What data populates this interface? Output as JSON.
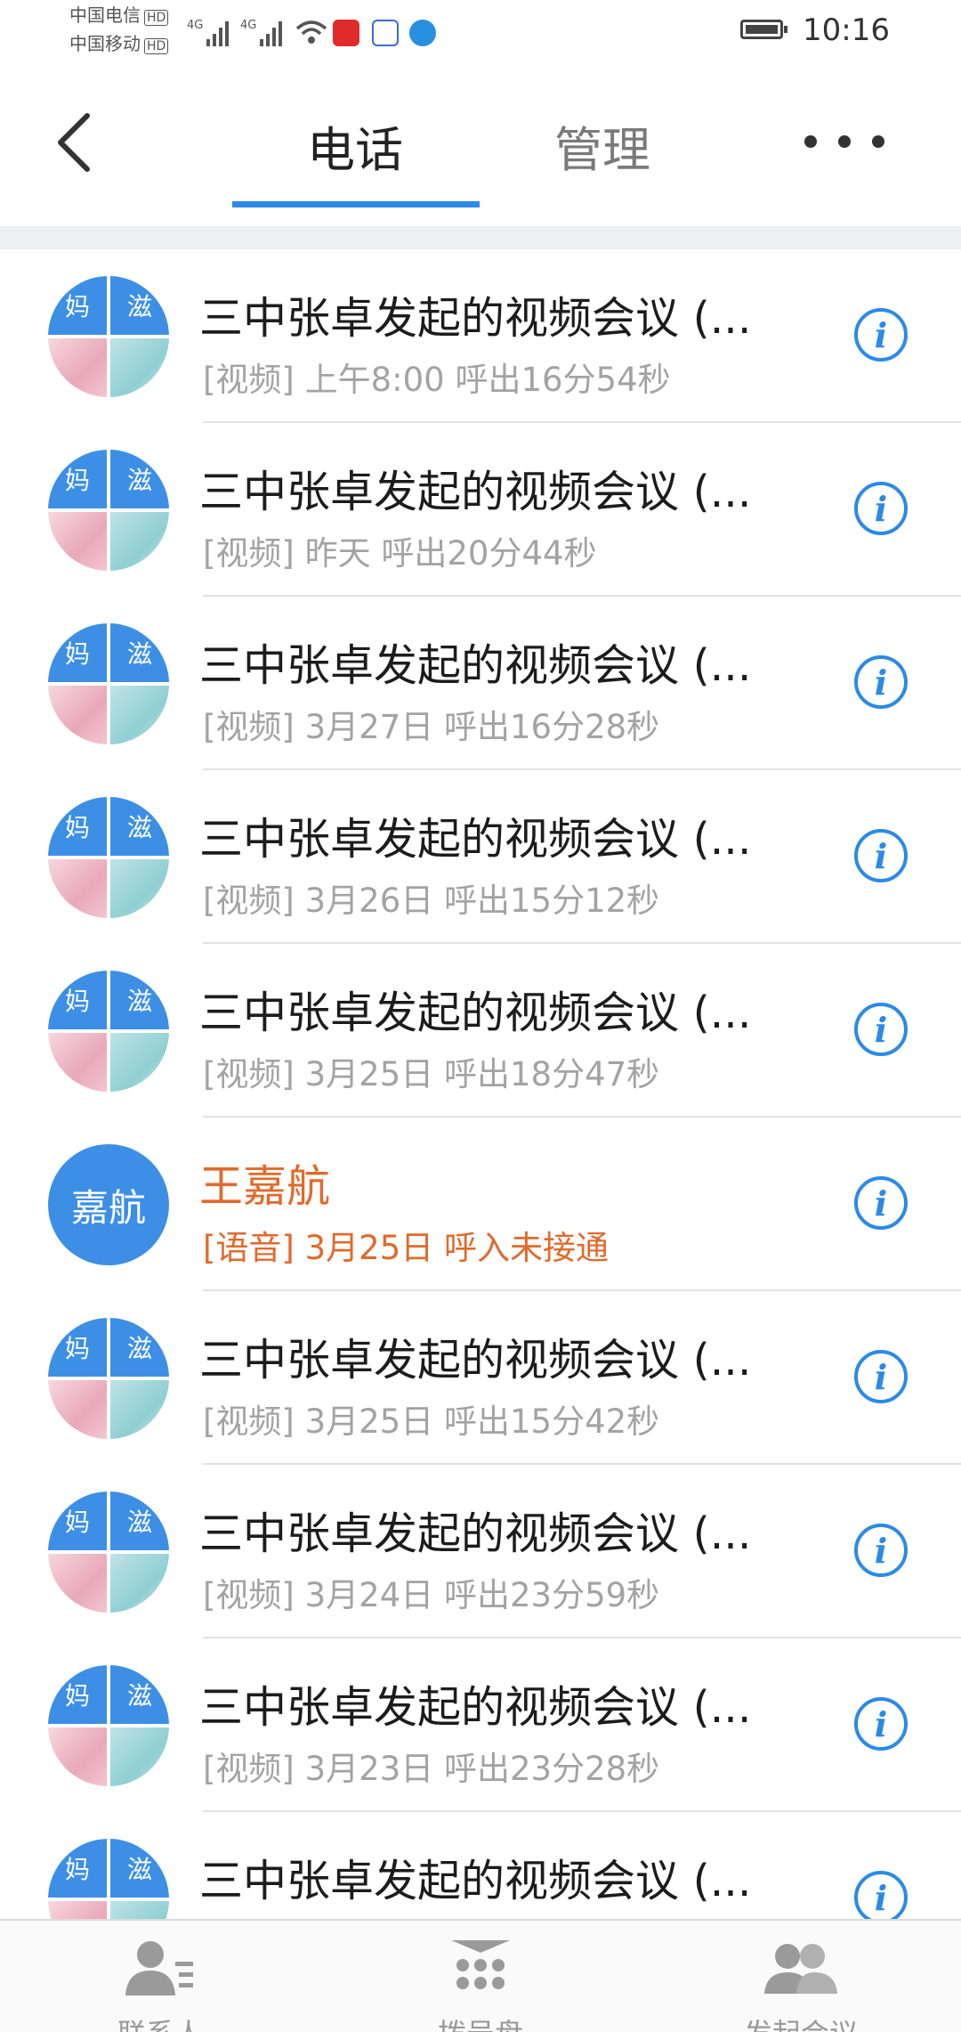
{
  "status_bar": {
    "carrier1": "中国电信",
    "carrier2": "中国移动",
    "hd": "HD",
    "network1": "4G",
    "network2": "4G",
    "time": "10:16",
    "icons": [
      "signal-icon",
      "signal-icon",
      "wifi-icon",
      "toutiao-app-icon",
      "baidu-app-icon",
      "browser-app-icon",
      "battery-icon"
    ]
  },
  "header": {
    "tab_phone": "电话",
    "tab_manage": "管理",
    "active_tab": "电话",
    "accent": "#2b8ae6"
  },
  "calls": [
    {
      "title": "三中张卓发起的视频会议 (...",
      "detail": "[视频] 上午8:00 呼出16分54秒",
      "avatar": [
        "妈",
        "滋"
      ],
      "missed": false
    },
    {
      "title": "三中张卓发起的视频会议 (...",
      "detail": "[视频] 昨天 呼出20分44秒",
      "avatar": [
        "妈",
        "滋"
      ],
      "missed": false
    },
    {
      "title": "三中张卓发起的视频会议 (...",
      "detail": "[视频] 3月27日 呼出16分28秒",
      "avatar": [
        "妈",
        "滋"
      ],
      "missed": false
    },
    {
      "title": "三中张卓发起的视频会议 (...",
      "detail": "[视频] 3月26日 呼出15分12秒",
      "avatar": [
        "妈",
        "滋"
      ],
      "missed": false
    },
    {
      "title": "三中张卓发起的视频会议 (...",
      "detail": "[视频] 3月25日 呼出18分47秒",
      "avatar": [
        "妈",
        "滋"
      ],
      "missed": false
    },
    {
      "title": "王嘉航",
      "detail": "[语音] 3月25日 呼入未接通",
      "avatar_text": "嘉航",
      "missed": true
    },
    {
      "title": "三中张卓发起的视频会议 (...",
      "detail": "[视频] 3月25日 呼出15分42秒",
      "avatar": [
        "妈",
        "滋"
      ],
      "missed": false
    },
    {
      "title": "三中张卓发起的视频会议 (...",
      "detail": "[视频] 3月24日 呼出23分59秒",
      "avatar": [
        "妈",
        "滋"
      ],
      "missed": false
    },
    {
      "title": "三中张卓发起的视频会议 (...",
      "detail": "[视频] 3月23日 呼出23分28秒",
      "avatar": [
        "妈",
        "滋"
      ],
      "missed": false
    },
    {
      "title": "三中张卓发起的视频会议 (...",
      "detail": "",
      "avatar": [
        "妈",
        "滋"
      ],
      "missed": false
    }
  ],
  "bottom_tabs": [
    {
      "label": "联系人",
      "icon": "contacts-icon"
    },
    {
      "label": "拨号盘",
      "icon": "dialpad-icon"
    },
    {
      "label": "发起会议",
      "icon": "group-icon"
    }
  ]
}
